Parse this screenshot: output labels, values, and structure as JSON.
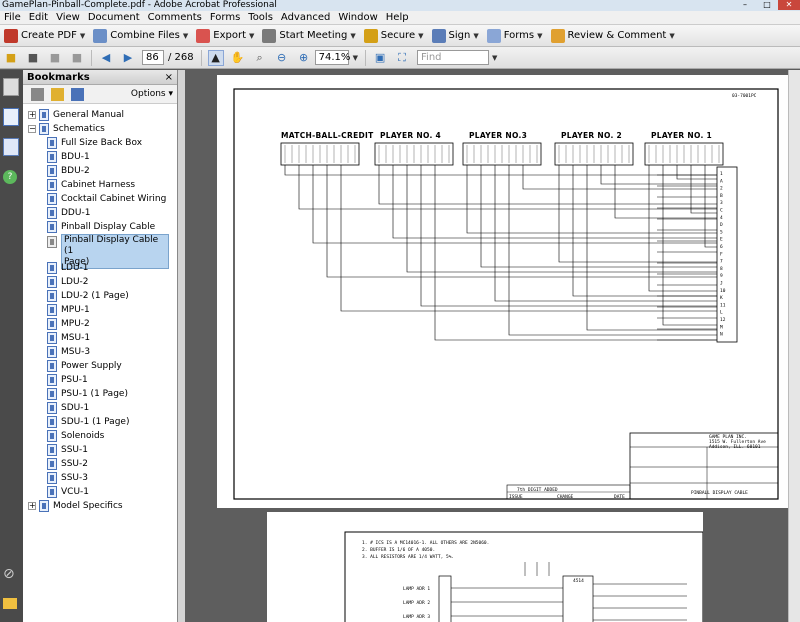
{
  "window": {
    "title": "GamePlan-Pinball-Complete.pdf - Adobe Acrobat Professional",
    "controls": [
      "–",
      "□",
      "✕"
    ]
  },
  "menu": [
    "File",
    "Edit",
    "View",
    "Document",
    "Comments",
    "Forms",
    "Tools",
    "Advanced",
    "Window",
    "Help"
  ],
  "toolbar": {
    "create_pdf": "Create PDF",
    "combine_files": "Combine Files",
    "export": "Export",
    "start_meeting": "Start Meeting",
    "secure": "Secure",
    "sign": "Sign",
    "forms": "Forms",
    "review_comment": "Review & Comment"
  },
  "nav": {
    "page_current": "86",
    "page_total": "/ 268",
    "zoom": "74.1%",
    "find_placeholder": "Find"
  },
  "bookmarks": {
    "title": "Bookmarks",
    "close": "×",
    "options": "Options ▾",
    "items": [
      {
        "label": "General Manual",
        "level": 0,
        "expander": "+"
      },
      {
        "label": "Schematics",
        "level": 0,
        "expander": "−"
      },
      {
        "label": "Full Size Back Box",
        "level": 1
      },
      {
        "label": "BDU-1",
        "level": 1
      },
      {
        "label": "BDU-2",
        "level": 1
      },
      {
        "label": "Cabinet Harness",
        "level": 1
      },
      {
        "label": "Cocktail Cabinet Wiring",
        "level": 1
      },
      {
        "label": "DDU-1",
        "level": 1
      },
      {
        "label": "Pinball Display Cable",
        "level": 1
      },
      {
        "label": "Pinball Display Cable (1",
        "label2": "Page)",
        "level": 1,
        "selected": true
      },
      {
        "label": "LDU-1",
        "level": 1
      },
      {
        "label": "LDU-2",
        "level": 1
      },
      {
        "label": "LDU-2 (1 Page)",
        "level": 1
      },
      {
        "label": "MPU-1",
        "level": 1
      },
      {
        "label": "MPU-2",
        "level": 1
      },
      {
        "label": "MSU-1",
        "level": 1
      },
      {
        "label": "MSU-3",
        "level": 1
      },
      {
        "label": "Power Supply",
        "level": 1
      },
      {
        "label": "PSU-1",
        "level": 1
      },
      {
        "label": "PSU-1 (1 Page)",
        "level": 1
      },
      {
        "label": "SDU-1",
        "level": 1
      },
      {
        "label": "SDU-1 (1 Page)",
        "level": 1
      },
      {
        "label": "Solenoids",
        "level": 1
      },
      {
        "label": "SSU-1",
        "level": 1
      },
      {
        "label": "SSU-2",
        "level": 1
      },
      {
        "label": "SSU-3",
        "level": 1
      },
      {
        "label": "VCU-1",
        "level": 1
      },
      {
        "label": "Model Specifics",
        "level": 0,
        "expander": "+"
      }
    ]
  },
  "schematic": {
    "connectors": [
      "MATCH-BALL-CREDIT",
      "PLAYER NO. 4",
      "PLAYER NO.3",
      "PLAYER NO. 2",
      "PLAYER NO. 1"
    ],
    "drawing_no": "03-7001PC",
    "right_pins": [
      "1",
      "A",
      "2",
      "B",
      "3",
      "C",
      "4",
      "D",
      "5",
      "E",
      "6",
      "F",
      "7",
      "8",
      "9",
      "J",
      "10",
      "K",
      "11",
      "L",
      "12",
      "M",
      "N"
    ],
    "company": "GAME PLAN INC.",
    "address": "1515 W. Fullerton Ave",
    "city": "Addison, ILL. 60101",
    "title_block": "PINBALL DISPLAY CABLE",
    "rev_note": "7th DIGIT ADDED",
    "change": "CHANGE",
    "issue": "ISSUE",
    "date": "DATE"
  },
  "schematic2": {
    "notes": [
      "1. # ICS IS A MC14016-1. ALL OTHERS ARE 2N5060.",
      "2. BUFFER IS 1/6 OF A 4050.",
      "3. ALL RESISTORS ARE 1/4 WATT, 5%."
    ],
    "lamp_rows": [
      "LAMP ADR 1",
      "LAMP ADR 2",
      "LAMP ADR 3"
    ],
    "ic_label": "4514"
  }
}
